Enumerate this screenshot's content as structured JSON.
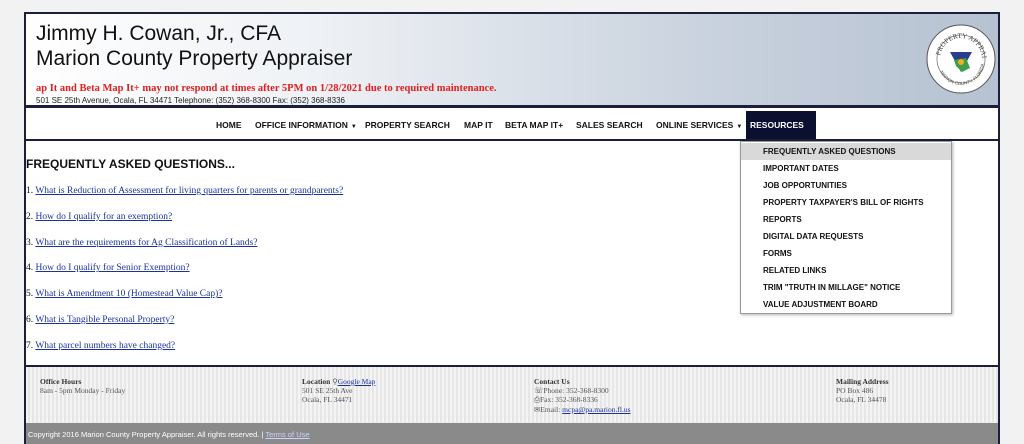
{
  "header": {
    "name": "Jimmy H. Cowan, Jr., CFA",
    "title": "Marion County Property Appraiser",
    "alert": "ap It and Beta Map It+ may not respond at times after 5PM on 1/28/2021 due to required maintenance.",
    "address": "501 SE 25th Avenue, Ocala, FL 34471 Telephone: (352) 368-8300 Fax: (352) 368-8336",
    "seal_top": "PROPERTY APPRAISER",
    "seal_bottom": "MARION COUNTY, FLORIDA"
  },
  "nav": {
    "items": [
      "HOME",
      "OFFICE INFORMATION",
      "PROPERTY SEARCH",
      "MAP IT",
      "BETA MAP IT+",
      "SALES SEARCH",
      "ONLINE SERVICES",
      "RESOURCES"
    ]
  },
  "dropdown": {
    "items": [
      "FREQUENTLY ASKED QUESTIONS",
      "IMPORTANT DATES",
      "JOB OPPORTUNITIES",
      "PROPERTY TAXPAYER'S BILL OF RIGHTS",
      "REPORTS",
      "DIGITAL DATA REQUESTS",
      "FORMS",
      "RELATED LINKS",
      "TRIM \"TRUTH IN MILLAGE\" NOTICE",
      "VALUE ADJUSTMENT BOARD"
    ]
  },
  "content": {
    "heading": "FREQUENTLY ASKED QUESTIONS...",
    "faqs": [
      {
        "num": "1.",
        "text": "What is Reduction of Assessment for living quarters for parents or grandparents?"
      },
      {
        "num": "2.",
        "text": "How do I qualify for an exemption?"
      },
      {
        "num": "3.",
        "text": "What are the requirements for Ag Classification of Lands?"
      },
      {
        "num": "4.",
        "text": "How do I qualify for Senior Exemption?"
      },
      {
        "num": "5.",
        "text": "What is Amendment 10 (Homestead Value Cap)?"
      },
      {
        "num": "6.",
        "text": "What is Tangible Personal Property?"
      },
      {
        "num": "7.",
        "text": "What parcel numbers have changed?"
      }
    ]
  },
  "footer": {
    "office_hours": {
      "head": "Office Hours",
      "line1": "8am - 5pm Monday - Friday"
    },
    "location": {
      "head": "Location",
      "link": "Google Map",
      "line1": "501 SE 25th Ave",
      "line2": "Ocala, FL 34471"
    },
    "contact": {
      "head": "Contact Us",
      "phone": "Phone: 352-368-8300",
      "fax": "Fax: 352-368-8336",
      "email_label": "Email:",
      "email": "mcpa@pa.marion.fl.us"
    },
    "mailing": {
      "head": "Mailing Address",
      "line1": "PO Box 486",
      "line2": "Ocala, FL 34478"
    },
    "copyright": "Copyright 2016 Marion County Property Appraiser. All rights reserved. |",
    "terms": "Terms of Use"
  },
  "colors": {
    "navy": "#1b1f3a",
    "alert": "#e02020",
    "link": "#1a3399",
    "active_nav": "#0b1030"
  }
}
